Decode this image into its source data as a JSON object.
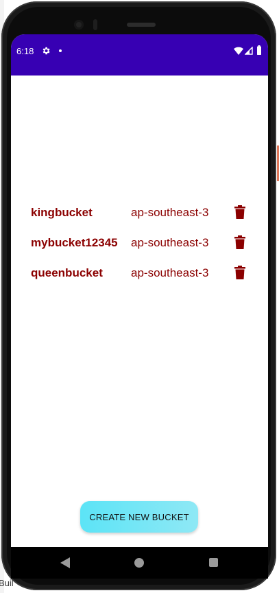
{
  "ide": {
    "bottom_text": "Buil"
  },
  "status_bar": {
    "time": "6:18",
    "icons": [
      "gear-icon",
      "notification-dot",
      "wifi-icon",
      "signal-icon",
      "battery-icon"
    ],
    "background": "#3700b3"
  },
  "buckets": [
    {
      "name": "kingbucket",
      "region": "ap-southeast-3",
      "action_icon": "trash-icon"
    },
    {
      "name": "mybucket12345",
      "region": "ap-southeast-3",
      "action_icon": "trash-icon"
    },
    {
      "name": "queenbucket",
      "region": "ap-southeast-3",
      "action_icon": "trash-icon"
    }
  ],
  "create_button": {
    "label": "CREATE NEW BUCKET"
  },
  "nav_bar": {
    "icons": [
      "back-icon",
      "home-icon",
      "recents-icon"
    ]
  },
  "colors": {
    "text_accent": "#8b0000",
    "button_gradient_start": "#5ce4f6",
    "button_gradient_end": "#8fe8f5"
  }
}
